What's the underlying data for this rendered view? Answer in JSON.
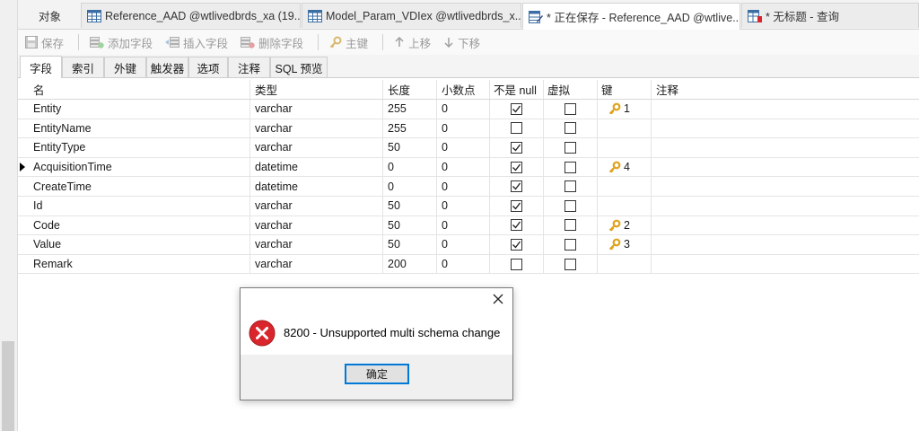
{
  "tabs": [
    {
      "label": "对象"
    },
    {
      "label": "Reference_AAD @wtlivedbrds_xa (19..."
    },
    {
      "label": "Model_Param_VDIex @wtlivedbrds_x..."
    },
    {
      "label": "* 正在保存 - Reference_AAD @wtlive..."
    },
    {
      "label": "* 无标题 - 查询"
    }
  ],
  "toolbar": {
    "save": "保存",
    "add_field": "添加字段",
    "insert_field": "插入字段",
    "delete_field": "删除字段",
    "primary_key": "主键",
    "move_up": "上移",
    "move_down": "下移"
  },
  "subtabs": [
    {
      "label": "字段"
    },
    {
      "label": "索引"
    },
    {
      "label": "外键"
    },
    {
      "label": "触发器"
    },
    {
      "label": "选项"
    },
    {
      "label": "注释"
    },
    {
      "label": "SQL 预览"
    }
  ],
  "table": {
    "headers": {
      "name": "名",
      "type": "类型",
      "length": "长度",
      "decimal": "小数点",
      "not_null": "不是 null",
      "virtual": "虚拟",
      "key": "键",
      "comment": "注释"
    },
    "rows": [
      {
        "name": "Entity",
        "type": "varchar",
        "length": "255",
        "decimal": "0",
        "not_null": true,
        "virtual": false,
        "key": "1",
        "comment": ""
      },
      {
        "name": "EntityName",
        "type": "varchar",
        "length": "255",
        "decimal": "0",
        "not_null": false,
        "virtual": false,
        "key": "",
        "comment": ""
      },
      {
        "name": "EntityType",
        "type": "varchar",
        "length": "50",
        "decimal": "0",
        "not_null": true,
        "virtual": false,
        "key": "",
        "comment": ""
      },
      {
        "name": "AcquisitionTime",
        "type": "datetime",
        "length": "0",
        "decimal": "0",
        "not_null": true,
        "virtual": false,
        "key": "4",
        "comment": ""
      },
      {
        "name": "CreateTime",
        "type": "datetime",
        "length": "0",
        "decimal": "0",
        "not_null": true,
        "virtual": false,
        "key": "",
        "comment": ""
      },
      {
        "name": "Id",
        "type": "varchar",
        "length": "50",
        "decimal": "0",
        "not_null": true,
        "virtual": false,
        "key": "",
        "comment": ""
      },
      {
        "name": "Code",
        "type": "varchar",
        "length": "50",
        "decimal": "0",
        "not_null": true,
        "virtual": false,
        "key": "2",
        "comment": ""
      },
      {
        "name": "Value",
        "type": "varchar",
        "length": "50",
        "decimal": "0",
        "not_null": true,
        "virtual": false,
        "key": "3",
        "comment": ""
      },
      {
        "name": "Remark",
        "type": "varchar",
        "length": "200",
        "decimal": "0",
        "not_null": false,
        "virtual": false,
        "key": "",
        "comment": ""
      }
    ]
  },
  "dialog": {
    "message": "8200 - Unsupported multi schema change",
    "ok_label": "确定",
    "icon": "error-icon"
  },
  "colors": {
    "error_red": "#d9262c",
    "key_gold": "#e0a21a",
    "focus_blue": "#0078d7"
  }
}
